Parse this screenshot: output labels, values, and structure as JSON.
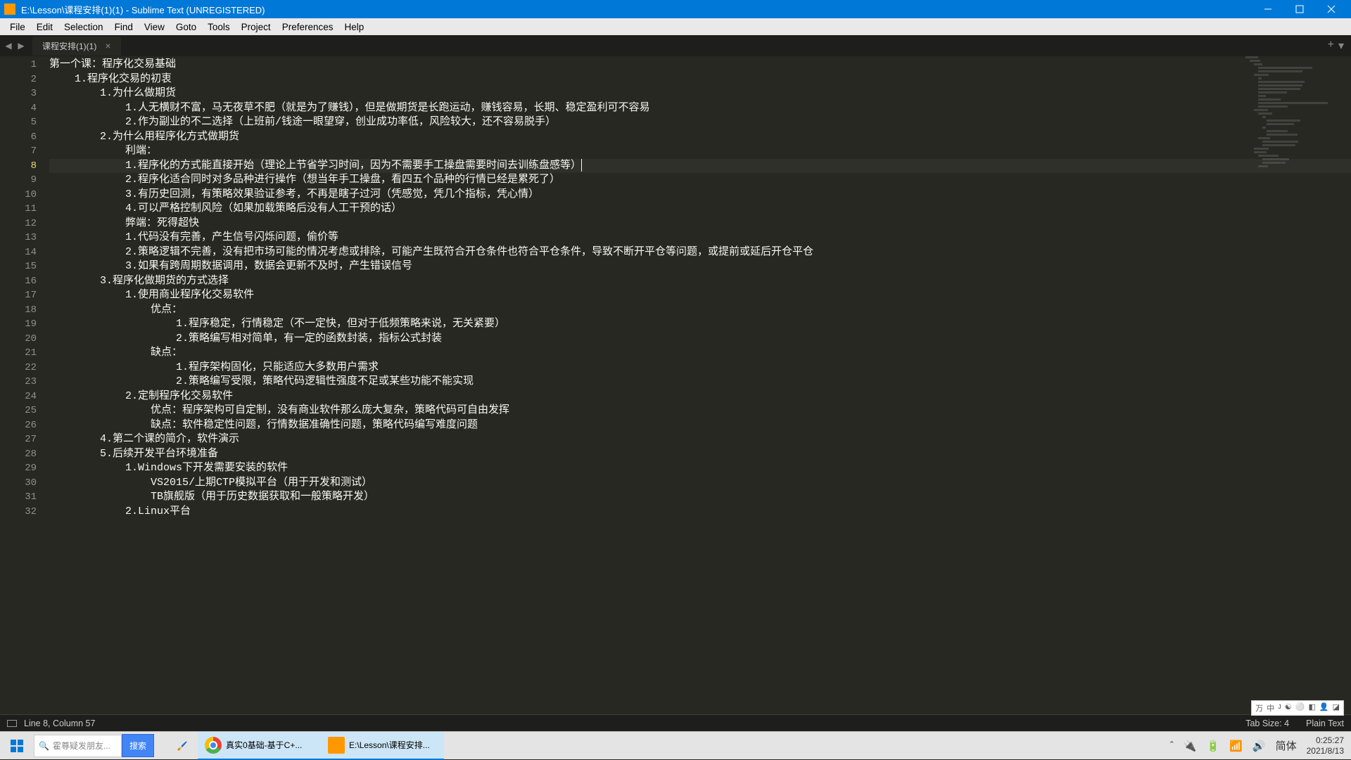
{
  "titlebar": {
    "title": "E:\\Lesson\\课程安排(1)(1) - Sublime Text (UNREGISTERED)"
  },
  "menubar": {
    "items": [
      "File",
      "Edit",
      "Selection",
      "Find",
      "View",
      "Goto",
      "Tools",
      "Project",
      "Preferences",
      "Help"
    ]
  },
  "tabs": {
    "active_tab": "课程安排(1)(1)"
  },
  "editor": {
    "active_line": 8,
    "lines": [
      "第一个课：程序化交易基础",
      "    1.程序化交易的初衷",
      "        1.为什么做期货",
      "            1.人无横财不富，马无夜草不肥（就是为了赚钱），但是做期货是长跑运动，赚钱容易，长期、稳定盈利可不容易",
      "            2.作为副业的不二选择（上班前/钱途一眼望穿，创业成功率低，风险较大，还不容易脱手）",
      "        2.为什么用程序化方式做期货",
      "            利端：",
      "            1.程序化的方式能直接开始（理论上节省学习时间，因为不需要手工操盘需要时间去训练盘感等）",
      "            2.程序化适合同时对多品种进行操作（想当年手工操盘，看四五个品种的行情已经是累死了）",
      "            3.有历史回测，有策略效果验证参考，不再是瞎子过河（凭感觉，凭几个指标，凭心情）",
      "            4.可以严格控制风险（如果加载策略后没有人工干预的话）",
      "            弊端：死得超快",
      "            1.代码没有完善，产生信号闪烁问题，偷价等",
      "            2.策略逻辑不完善，没有把市场可能的情况考虑或排除，可能产生既符合开仓条件也符合平仓条件，导致不断开平仓等问题，或提前或延后开仓平仓",
      "            3.如果有跨周期数据调用，数据会更新不及时，产生错误信号",
      "        3.程序化做期货的方式选择",
      "            1.使用商业程序化交易软件",
      "                优点：",
      "                    1.程序稳定，行情稳定（不一定快，但对于低频策略来说，无关紧要）",
      "                    2.策略编写相对简单，有一定的函数封装，指标公式封装",
      "                缺点：",
      "                    1.程序架构固化，只能适应大多数用户需求",
      "                    2.策略编写受限，策略代码逻辑性强度不足或某些功能不能实现",
      "            2.定制程序化交易软件",
      "                优点：程序架构可自定制，没有商业软件那么庞大复杂，策略代码可自由发挥",
      "                缺点：软件稳定性问题，行情数据准确性问题，策略代码编写难度问题",
      "        4.第二个课的简介，软件演示",
      "        5.后续开发平台环境准备",
      "            1.Windows下开发需要安装的软件",
      "                VS2015/上期CTP模拟平台（用于开发和测试）",
      "                TB旗舰版（用于历史数据获取和一般策略开发）",
      "            2.Linux平台"
    ]
  },
  "statusbar": {
    "position": "Line 8, Column 57",
    "tabsize": "Tab Size: 4",
    "syntax": "Plain Text"
  },
  "taskbar": {
    "search_placeholder": "霍尊疑发朋友...",
    "search_btn": "搜索",
    "chrome_task": "真实0基础-基于C+...",
    "sublime_task": "E:\\Lesson\\课程安排...",
    "ime": "简体",
    "time": "0:25:27",
    "date": "2021/8/13"
  },
  "tray_widget": {
    "chars": [
      "万",
      "中",
      "ᴊ",
      "☯",
      "⚪",
      "◧",
      "👤",
      "◪"
    ]
  }
}
